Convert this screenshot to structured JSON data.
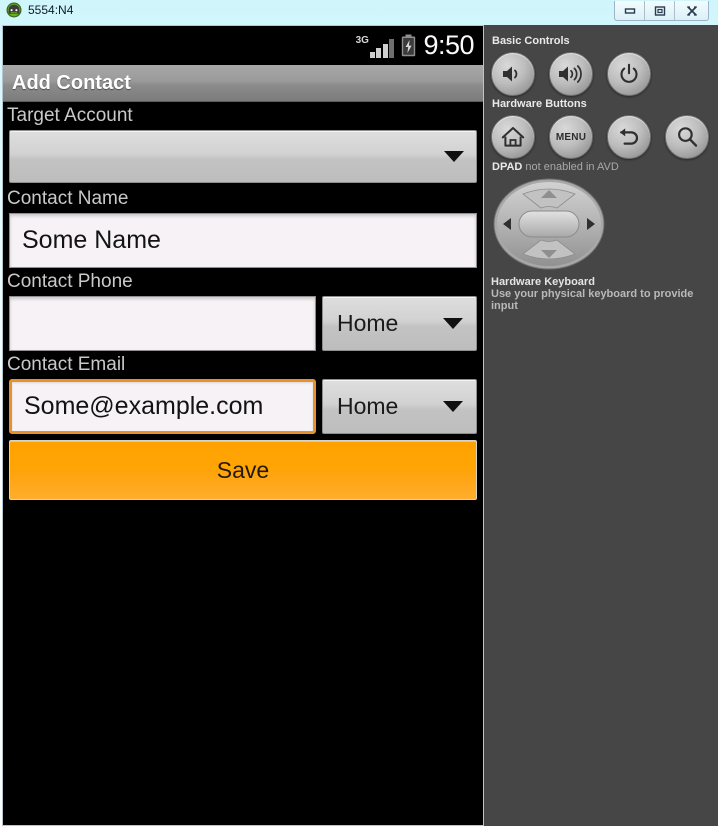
{
  "window": {
    "title": "5554:N4",
    "icon": "android-robot-icon",
    "buttons": {
      "minimize": "minimize-icon",
      "maximize": "maximize-icon",
      "close": "close-icon"
    }
  },
  "status_bar": {
    "network_type": "3G",
    "signal_icon": "signal-bars-icon",
    "battery_icon": "battery-charging-icon",
    "time": "9:50"
  },
  "action_bar": {
    "title": "Add Contact"
  },
  "form": {
    "target_account": {
      "label": "Target Account",
      "value": "",
      "caret_icon": "chevron-down-icon"
    },
    "contact_name": {
      "label": "Contact Name",
      "value": "Some Name"
    },
    "contact_phone": {
      "label": "Contact Phone",
      "value": "",
      "type_value": "Home",
      "caret_icon": "chevron-down-icon"
    },
    "contact_email": {
      "label": "Contact Email",
      "value": "Some@example.com",
      "type_value": "Home",
      "caret_icon": "chevron-down-icon"
    },
    "save_label": "Save"
  },
  "panel": {
    "basic_controls_heading": "Basic Controls",
    "basic_controls": [
      {
        "name": "volume-down-button",
        "icon": "speaker-low-icon"
      },
      {
        "name": "volume-up-button",
        "icon": "speaker-high-icon"
      },
      {
        "name": "power-button",
        "icon": "power-icon"
      }
    ],
    "hardware_buttons_heading": "Hardware Buttons",
    "hardware_buttons": [
      {
        "name": "home-button",
        "icon": "home-icon",
        "label": ""
      },
      {
        "name": "menu-button",
        "icon": "menu-text-icon",
        "label": "MENU"
      },
      {
        "name": "back-button",
        "icon": "back-arrow-icon",
        "label": ""
      },
      {
        "name": "search-button",
        "icon": "search-icon",
        "label": ""
      }
    ],
    "dpad_heading": "DPAD",
    "dpad_status": " not enabled in AVD",
    "dpad_icon": "dpad-icon",
    "keyboard_title": "Hardware Keyboard",
    "keyboard_sub": "Use your physical keyboard to provide input"
  },
  "colors": {
    "accent_orange": "#FFA200",
    "focus_orange": "#E8912A",
    "panel_bg": "#464646",
    "screen_bg": "#000000"
  }
}
